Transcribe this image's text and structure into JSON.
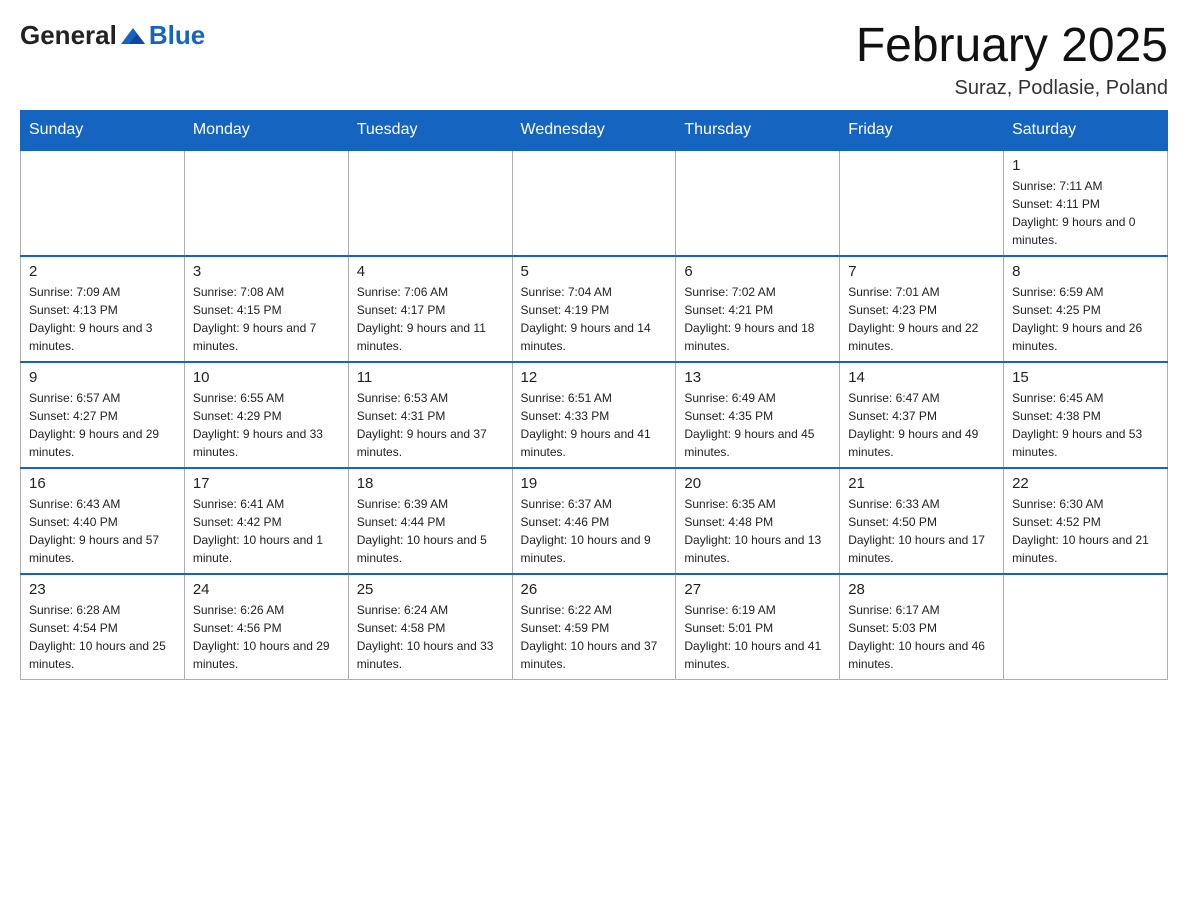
{
  "header": {
    "logo_general": "General",
    "logo_blue": "Blue",
    "month_title": "February 2025",
    "location": "Suraz, Podlasie, Poland"
  },
  "days_of_week": [
    "Sunday",
    "Monday",
    "Tuesday",
    "Wednesday",
    "Thursday",
    "Friday",
    "Saturday"
  ],
  "weeks": [
    [
      {
        "day": "",
        "info": ""
      },
      {
        "day": "",
        "info": ""
      },
      {
        "day": "",
        "info": ""
      },
      {
        "day": "",
        "info": ""
      },
      {
        "day": "",
        "info": ""
      },
      {
        "day": "",
        "info": ""
      },
      {
        "day": "1",
        "info": "Sunrise: 7:11 AM\nSunset: 4:11 PM\nDaylight: 9 hours and 0 minutes."
      }
    ],
    [
      {
        "day": "2",
        "info": "Sunrise: 7:09 AM\nSunset: 4:13 PM\nDaylight: 9 hours and 3 minutes."
      },
      {
        "day": "3",
        "info": "Sunrise: 7:08 AM\nSunset: 4:15 PM\nDaylight: 9 hours and 7 minutes."
      },
      {
        "day": "4",
        "info": "Sunrise: 7:06 AM\nSunset: 4:17 PM\nDaylight: 9 hours and 11 minutes."
      },
      {
        "day": "5",
        "info": "Sunrise: 7:04 AM\nSunset: 4:19 PM\nDaylight: 9 hours and 14 minutes."
      },
      {
        "day": "6",
        "info": "Sunrise: 7:02 AM\nSunset: 4:21 PM\nDaylight: 9 hours and 18 minutes."
      },
      {
        "day": "7",
        "info": "Sunrise: 7:01 AM\nSunset: 4:23 PM\nDaylight: 9 hours and 22 minutes."
      },
      {
        "day": "8",
        "info": "Sunrise: 6:59 AM\nSunset: 4:25 PM\nDaylight: 9 hours and 26 minutes."
      }
    ],
    [
      {
        "day": "9",
        "info": "Sunrise: 6:57 AM\nSunset: 4:27 PM\nDaylight: 9 hours and 29 minutes."
      },
      {
        "day": "10",
        "info": "Sunrise: 6:55 AM\nSunset: 4:29 PM\nDaylight: 9 hours and 33 minutes."
      },
      {
        "day": "11",
        "info": "Sunrise: 6:53 AM\nSunset: 4:31 PM\nDaylight: 9 hours and 37 minutes."
      },
      {
        "day": "12",
        "info": "Sunrise: 6:51 AM\nSunset: 4:33 PM\nDaylight: 9 hours and 41 minutes."
      },
      {
        "day": "13",
        "info": "Sunrise: 6:49 AM\nSunset: 4:35 PM\nDaylight: 9 hours and 45 minutes."
      },
      {
        "day": "14",
        "info": "Sunrise: 6:47 AM\nSunset: 4:37 PM\nDaylight: 9 hours and 49 minutes."
      },
      {
        "day": "15",
        "info": "Sunrise: 6:45 AM\nSunset: 4:38 PM\nDaylight: 9 hours and 53 minutes."
      }
    ],
    [
      {
        "day": "16",
        "info": "Sunrise: 6:43 AM\nSunset: 4:40 PM\nDaylight: 9 hours and 57 minutes."
      },
      {
        "day": "17",
        "info": "Sunrise: 6:41 AM\nSunset: 4:42 PM\nDaylight: 10 hours and 1 minute."
      },
      {
        "day": "18",
        "info": "Sunrise: 6:39 AM\nSunset: 4:44 PM\nDaylight: 10 hours and 5 minutes."
      },
      {
        "day": "19",
        "info": "Sunrise: 6:37 AM\nSunset: 4:46 PM\nDaylight: 10 hours and 9 minutes."
      },
      {
        "day": "20",
        "info": "Sunrise: 6:35 AM\nSunset: 4:48 PM\nDaylight: 10 hours and 13 minutes."
      },
      {
        "day": "21",
        "info": "Sunrise: 6:33 AM\nSunset: 4:50 PM\nDaylight: 10 hours and 17 minutes."
      },
      {
        "day": "22",
        "info": "Sunrise: 6:30 AM\nSunset: 4:52 PM\nDaylight: 10 hours and 21 minutes."
      }
    ],
    [
      {
        "day": "23",
        "info": "Sunrise: 6:28 AM\nSunset: 4:54 PM\nDaylight: 10 hours and 25 minutes."
      },
      {
        "day": "24",
        "info": "Sunrise: 6:26 AM\nSunset: 4:56 PM\nDaylight: 10 hours and 29 minutes."
      },
      {
        "day": "25",
        "info": "Sunrise: 6:24 AM\nSunset: 4:58 PM\nDaylight: 10 hours and 33 minutes."
      },
      {
        "day": "26",
        "info": "Sunrise: 6:22 AM\nSunset: 4:59 PM\nDaylight: 10 hours and 37 minutes."
      },
      {
        "day": "27",
        "info": "Sunrise: 6:19 AM\nSunset: 5:01 PM\nDaylight: 10 hours and 41 minutes."
      },
      {
        "day": "28",
        "info": "Sunrise: 6:17 AM\nSunset: 5:03 PM\nDaylight: 10 hours and 46 minutes."
      },
      {
        "day": "",
        "info": ""
      }
    ]
  ]
}
